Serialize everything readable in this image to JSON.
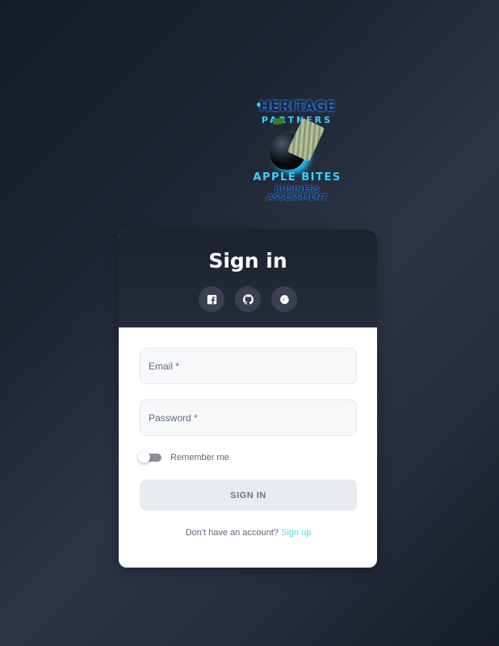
{
  "logo": {
    "line1": "HERITAGE",
    "line2": "PARTNERS",
    "line3": "APPLE BITES",
    "line4": "BUSINESS",
    "line5": "ASSESSMENT"
  },
  "card": {
    "title": "Sign in",
    "social": [
      {
        "icon": "facebook-icon"
      },
      {
        "icon": "github-icon"
      },
      {
        "icon": "google-icon"
      }
    ]
  },
  "form": {
    "email_placeholder": "Email *",
    "password_placeholder": "Password *",
    "remember_label": "Remember me",
    "remember_checked": false,
    "signin_label": "SIGN IN",
    "signup_prompt": "Don't have an account?",
    "signup_link": "Sign up"
  },
  "colors": {
    "accent": "#5ad2d8",
    "header_bg": "#1d2230",
    "logo_cyan": "#3ad0ff"
  }
}
